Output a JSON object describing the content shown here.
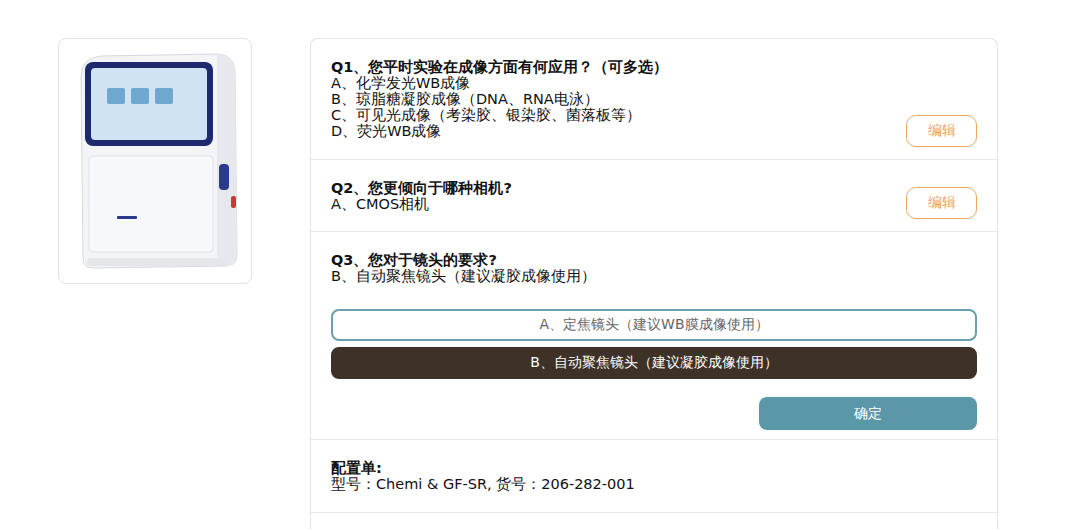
{
  "questions": [
    {
      "kind": "answered",
      "title": "Q1、您平时实验在成像方面有何应用？（可多选）",
      "answers": [
        "A、化学发光WB成像",
        "B、琼脂糖凝胶成像（DNA、RNA电泳）",
        "C、可见光成像（考染胶、银染胶、菌落板等）",
        "D、荧光WB成像"
      ],
      "edit_button": "编辑"
    },
    {
      "kind": "answered",
      "title": "Q2、您更倾向于哪种相机?",
      "answers": [
        "A、CMOS相机"
      ],
      "edit_button": "编辑"
    },
    {
      "kind": "active",
      "title": "Q3、您对于镜头的要求?",
      "answers": [
        "B、自动聚焦镜头（建议凝胶成像使用）"
      ],
      "options": [
        {
          "label": "A、定焦镜头（建议WB膜成像使用）",
          "selected": false
        },
        {
          "label": "B、自动聚焦镜头（建议凝胶成像使用）",
          "selected": true
        }
      ],
      "confirm_button": "确定"
    }
  ],
  "config": {
    "title": "配置单:",
    "text": "型号：Chemi & GF-SR, 货号：206-282-001"
  }
}
